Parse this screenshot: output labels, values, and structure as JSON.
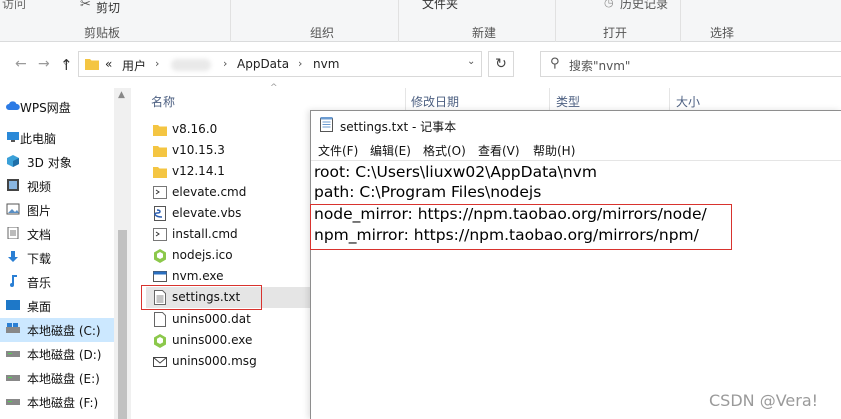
{
  "ribbon": {
    "partial_labels": {
      "access": "访问",
      "cut": "剪切",
      "file_folder": "文件夹",
      "history": "历史记录"
    },
    "groups": {
      "clipboard": "剪贴板",
      "organize": "组织",
      "new": "新建",
      "open": "打开",
      "select": "选择"
    }
  },
  "address": {
    "overflow": "«",
    "crumbs": [
      "用户",
      "AppData",
      "nvm"
    ],
    "search_placeholder": "搜索\"nvm\""
  },
  "nav": {
    "items": [
      {
        "label": "WPS网盘",
        "icon": "cloud-icon"
      },
      {
        "label": "此电脑",
        "icon": "computer-icon"
      },
      {
        "label": "3D 对象",
        "icon": "cube-icon"
      },
      {
        "label": "视频",
        "icon": "video-icon"
      },
      {
        "label": "图片",
        "icon": "picture-icon"
      },
      {
        "label": "文档",
        "icon": "document-icon"
      },
      {
        "label": "下载",
        "icon": "download-icon"
      },
      {
        "label": "音乐",
        "icon": "music-icon"
      },
      {
        "label": "桌面",
        "icon": "desktop-icon"
      },
      {
        "label": "本地磁盘 (C:)",
        "icon": "drive-icon"
      },
      {
        "label": "本地磁盘 (D:)",
        "icon": "drive-icon"
      },
      {
        "label": "本地磁盘 (E:)",
        "icon": "drive-icon"
      },
      {
        "label": "本地磁盘 (F:)",
        "icon": "drive-icon"
      }
    ]
  },
  "columns": {
    "name": "名称",
    "modified": "修改日期",
    "type": "类型",
    "size": "大小"
  },
  "files": [
    {
      "name": "v8.16.0",
      "icon": "folder-icon"
    },
    {
      "name": "v10.15.3",
      "icon": "folder-icon"
    },
    {
      "name": "v12.14.1",
      "icon": "folder-icon"
    },
    {
      "name": "elevate.cmd",
      "icon": "cmd-file-icon"
    },
    {
      "name": "elevate.vbs",
      "icon": "vbs-file-icon"
    },
    {
      "name": "install.cmd",
      "icon": "cmd-file-icon"
    },
    {
      "name": "nodejs.ico",
      "icon": "nodejs-icon"
    },
    {
      "name": "nvm.exe",
      "icon": "exe-file-icon"
    },
    {
      "name": "settings.txt",
      "icon": "text-file-icon"
    },
    {
      "name": "unins000.dat",
      "icon": "blank-file-icon"
    },
    {
      "name": "unins000.exe",
      "icon": "nodejs-icon"
    },
    {
      "name": "unins000.msg",
      "icon": "mail-file-icon"
    }
  ],
  "notepad": {
    "title": "settings.txt - 记事本",
    "menu": [
      "文件(F)",
      "编辑(E)",
      "格式(O)",
      "查看(V)",
      "帮助(H)"
    ],
    "lines": [
      "root: C:\\Users\\liuxw02\\AppData\\nvm",
      "path: C:\\Program Files\\nodejs",
      "node_mirror: https://npm.taobao.org/mirrors/node/",
      "npm_mirror: https://npm.taobao.org/mirrors/npm/"
    ]
  },
  "watermark": "CSDN @Vera!",
  "colors": {
    "highlight_box": "#d8332e",
    "selected_nav": "#cce8ff",
    "folder": "#f4c542",
    "header_text": "#4d6082"
  }
}
